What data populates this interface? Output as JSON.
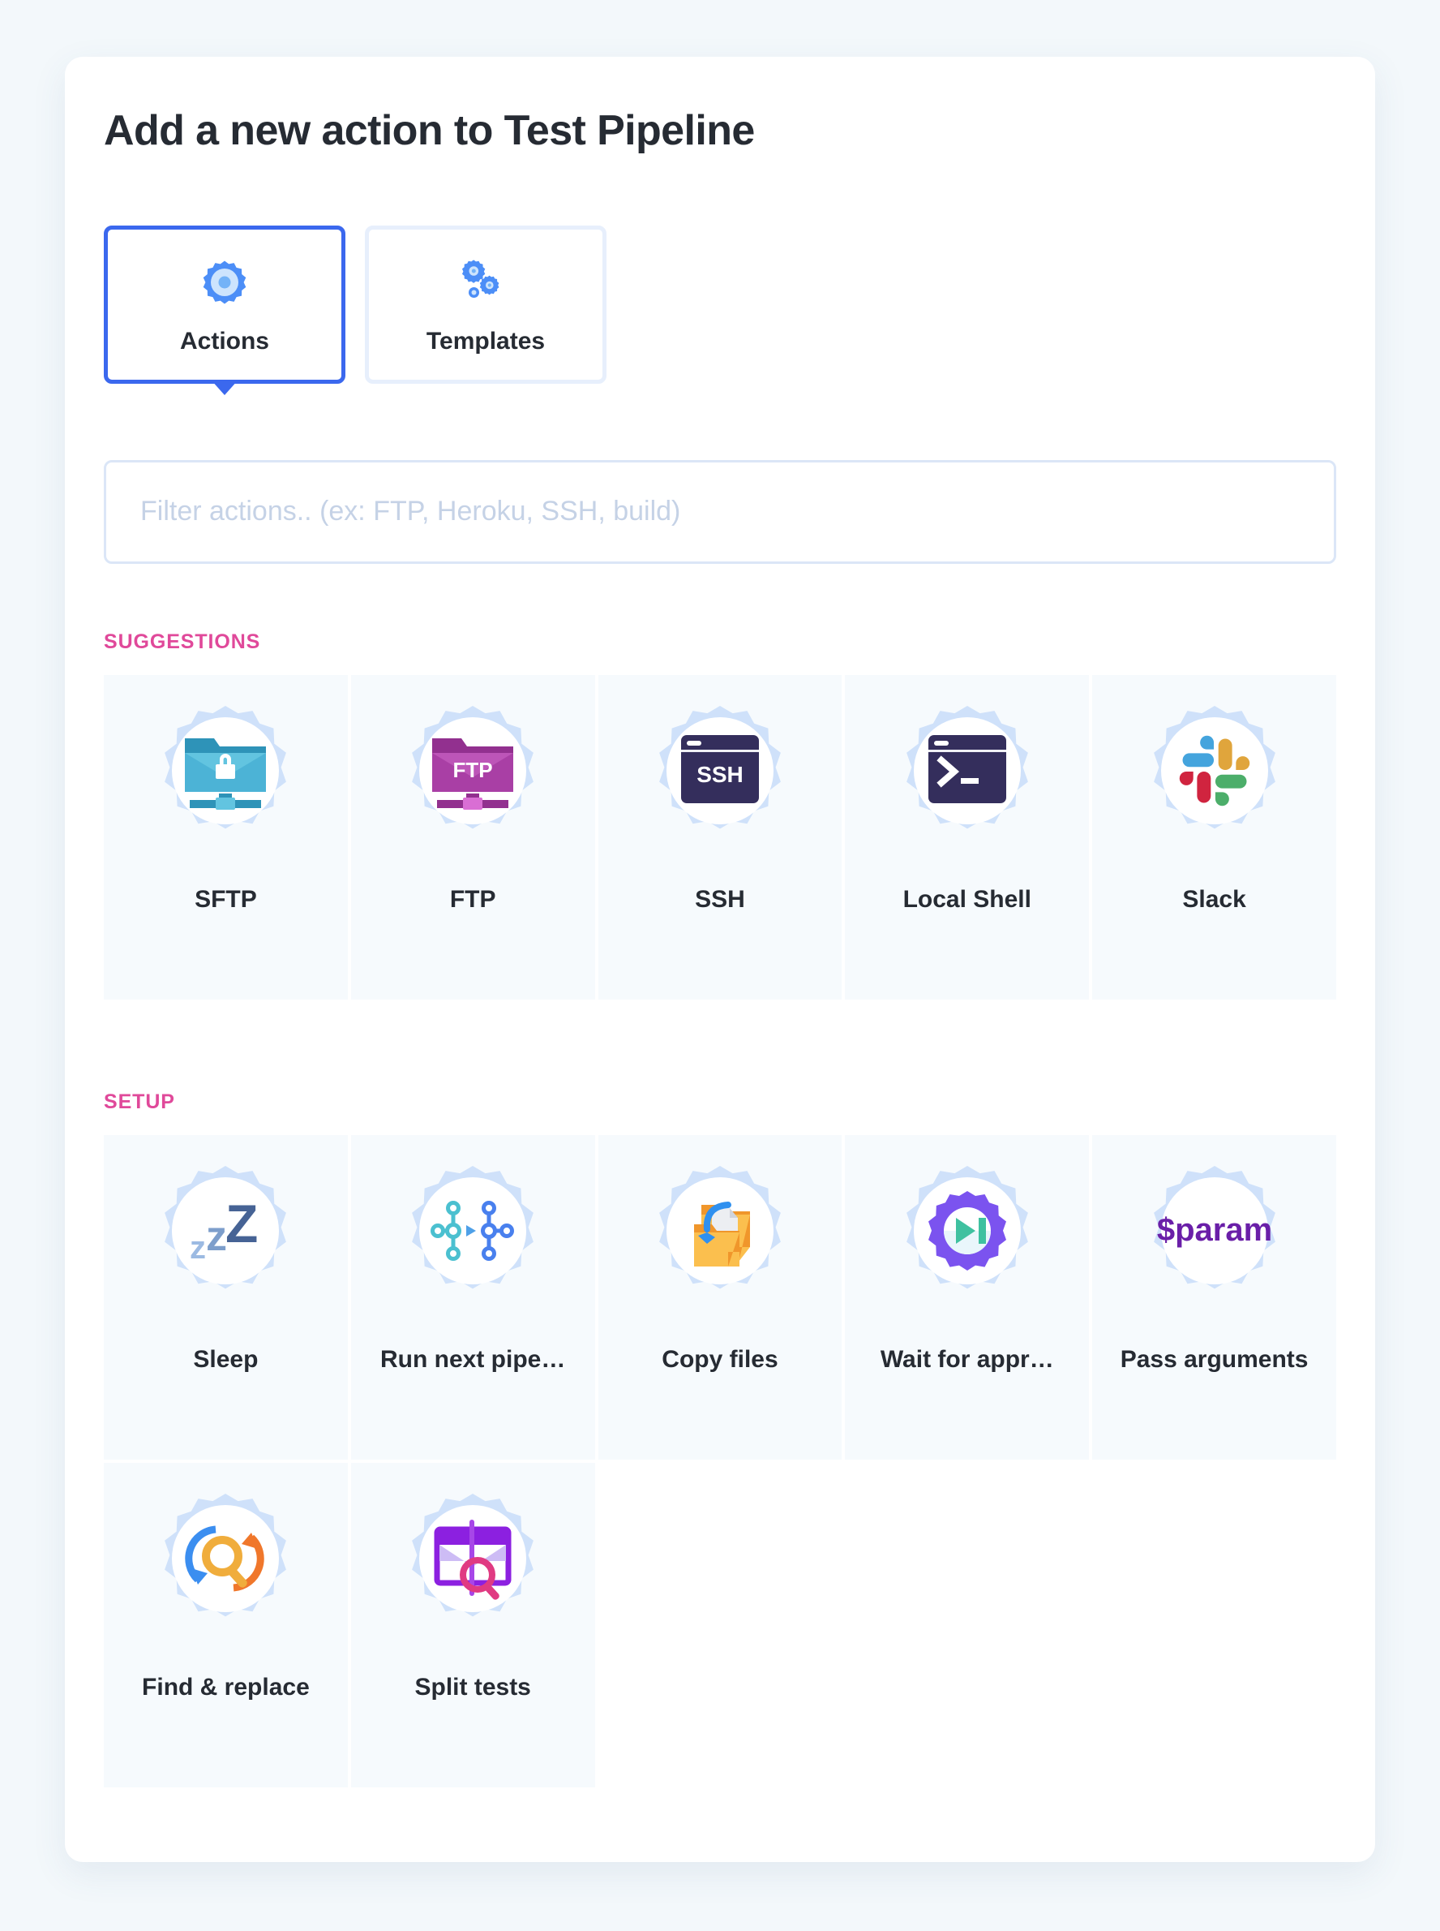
{
  "header": {
    "title": "Add a new action to Test Pipeline"
  },
  "tabs": [
    {
      "label": "Actions",
      "icon": "single-gear-icon",
      "active": true
    },
    {
      "label": "Templates",
      "icon": "multi-gears-icon",
      "active": false
    }
  ],
  "search": {
    "value": "",
    "placeholder": "Filter actions.. (ex: FTP, Heroku, SSH, build)"
  },
  "sections": [
    {
      "key": "suggestions",
      "title": "SUGGESTIONS",
      "items": [
        {
          "label": "SFTP",
          "icon": "sftp-folder-lock-icon"
        },
        {
          "label": "FTP",
          "icon": "ftp-folder-icon"
        },
        {
          "label": "SSH",
          "icon": "ssh-terminal-icon"
        },
        {
          "label": "Local Shell",
          "icon": "local-shell-terminal-icon"
        },
        {
          "label": "Slack",
          "icon": "slack-logo-icon"
        }
      ]
    },
    {
      "key": "setup",
      "title": "SETUP",
      "items": [
        {
          "label": "Sleep",
          "icon": "sleep-zzz-icon"
        },
        {
          "label": "Run next pipe…",
          "icon": "run-next-pipeline-icon"
        },
        {
          "label": "Copy files",
          "icon": "copy-files-folders-icon"
        },
        {
          "label": "Wait for appr…",
          "icon": "wait-for-approval-gear-icon"
        },
        {
          "label": "Pass arguments",
          "icon": "pass-arguments-param-icon"
        },
        {
          "label": "Find & replace",
          "icon": "find-replace-magnifier-icon"
        },
        {
          "label": "Split tests",
          "icon": "split-tests-magnifier-icon"
        }
      ]
    }
  ],
  "colors": {
    "page_background": "#f3f8fb",
    "card_background": "#ffffff",
    "accent_blue": "#3b68ee",
    "section_pink": "#e0499a",
    "tile_background": "#f6fafd",
    "gear_badge_blue": "#cfe1fa",
    "input_border": "#dbe6f7",
    "text_dark": "#262b33",
    "placeholder": "#c5d2e6"
  }
}
